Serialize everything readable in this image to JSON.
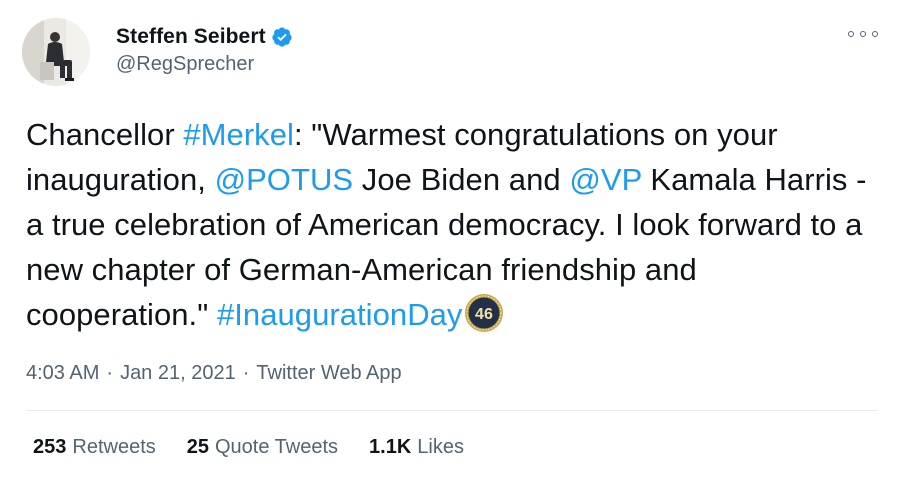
{
  "author": {
    "display_name": "Steffen Seibert",
    "handle": "@RegSprecher"
  },
  "tweet": {
    "segments": [
      {
        "text": "Chancellor ",
        "link": false
      },
      {
        "text": "#Merkel",
        "link": true
      },
      {
        "text": ": \"Warmest congratulations on your inauguration, ",
        "link": false
      },
      {
        "text": "@POTUS",
        "link": true
      },
      {
        "text": " Joe Biden and ",
        "link": false
      },
      {
        "text": "@VP",
        "link": true
      },
      {
        "text": " Kamala Harris - a true celebration of American democracy. I look forward to a new chapter of German-American friendship and cooperation.\" ",
        "link": false
      },
      {
        "text": "#InaugurationDay",
        "link": true
      }
    ],
    "hashflag_number": "46"
  },
  "meta": {
    "time": "4:03 AM",
    "separator": "·",
    "date": "Jan 21, 2021",
    "source": "Twitter Web App"
  },
  "stats": {
    "retweets_count": "253",
    "retweets_label": "Retweets",
    "quotes_count": "25",
    "quotes_label": "Quote Tweets",
    "likes_count": "1.1K",
    "likes_label": "Likes"
  },
  "colors": {
    "link": "#1d9bf0",
    "verified": "#1d9bf0",
    "secondary_text": "#536471",
    "primary_text": "#0f1419"
  },
  "icons": {
    "verified": "verified-badge-icon",
    "more": "more-options-icon",
    "hashflag": "inauguration-46-hashflag-icon"
  }
}
